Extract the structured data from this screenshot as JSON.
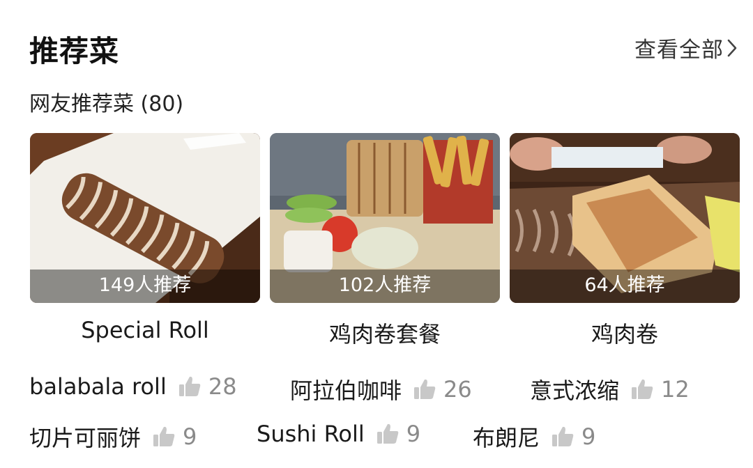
{
  "header": {
    "title": "推荐菜",
    "view_all_label": "查看全部"
  },
  "subtitle": "网友推荐菜 (80)",
  "cards": [
    {
      "name": "Special Roll",
      "recommend": "149人推荐"
    },
    {
      "name": "鸡肉卷套餐",
      "recommend": "102人推荐"
    },
    {
      "name": "鸡肉卷",
      "recommend": "64人推荐"
    }
  ],
  "dishes": [
    {
      "name": "balabala roll",
      "count": "28"
    },
    {
      "name": "阿拉伯咖啡",
      "count": "26"
    },
    {
      "name": "意式浓缩",
      "count": "12"
    },
    {
      "name": "切片可丽饼",
      "count": "9"
    },
    {
      "name": "Sushi Roll",
      "count": "9"
    },
    {
      "name": "布朗尼",
      "count": "9"
    }
  ],
  "icons": {
    "view_all": "chevron-right-icon",
    "like": "thumbs-up-icon"
  },
  "colors": {
    "text_primary": "#1a1a1a",
    "text_secondary": "#8a8a8a",
    "icon_gray": "#c8c8c8"
  }
}
